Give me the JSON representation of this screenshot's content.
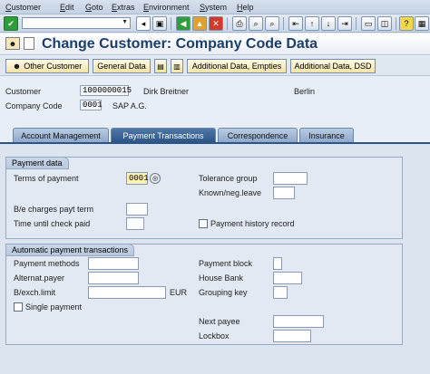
{
  "menu": [
    "Customer",
    "Edit",
    "Goto",
    "Extras",
    "Environment",
    "System",
    "Help"
  ],
  "title": "Change Customer: Company Code Data",
  "app_toolbar": {
    "other_customer": "Other Customer",
    "general_data": "General Data",
    "additional_empties": "Additional Data, Empties",
    "additional_dsd": "Additional Data, DSD"
  },
  "header": {
    "customer_label": "Customer",
    "customer_value": "1000000015",
    "customer_name": "Dirk Breitner",
    "customer_city": "Berlin",
    "company_code_label": "Company Code",
    "company_code_value": "0001",
    "company_name": "SAP A.G."
  },
  "tabs": [
    {
      "label": "Account Management",
      "active": false
    },
    {
      "label": "Payment Transactions",
      "active": true
    },
    {
      "label": "Correspondence",
      "active": false
    },
    {
      "label": "Insurance",
      "active": false
    }
  ],
  "payment_data": {
    "title": "Payment data",
    "terms_of_payment_label": "Terms of payment",
    "terms_of_payment_value": "0001",
    "tolerance_group_label": "Tolerance group",
    "known_neg_leave_label": "Known/neg.leave",
    "be_charges_label": "B/e charges payt term",
    "time_until_check_label": "Time until check paid",
    "payment_history_label": "Payment history record"
  },
  "auto_payment": {
    "title": "Automatic payment transactions",
    "payment_methods_label": "Payment methods",
    "alternat_payer_label": "Alternat.payer",
    "bexch_limit_label": "B/exch.limit",
    "currency": "EUR",
    "single_payment_label": "Single payment",
    "payment_block_label": "Payment block",
    "house_bank_label": "House Bank",
    "grouping_key_label": "Grouping key",
    "next_payee_label": "Next payee",
    "lockbox_label": "Lockbox"
  },
  "icons": [
    "enter-icon",
    "save-icon",
    "back-icon",
    "exit-icon",
    "cancel-icon",
    "print-icon",
    "find-icon",
    "find-next-icon",
    "first-page-icon",
    "prev-page-icon",
    "next-page-icon",
    "last-page-icon",
    "create-session-icon",
    "shortcut-icon",
    "help-icon",
    "customize-icon"
  ],
  "colors": {
    "accent": "#2c5487",
    "title": "#1b3e6b",
    "required_field": "#fff4b3"
  }
}
